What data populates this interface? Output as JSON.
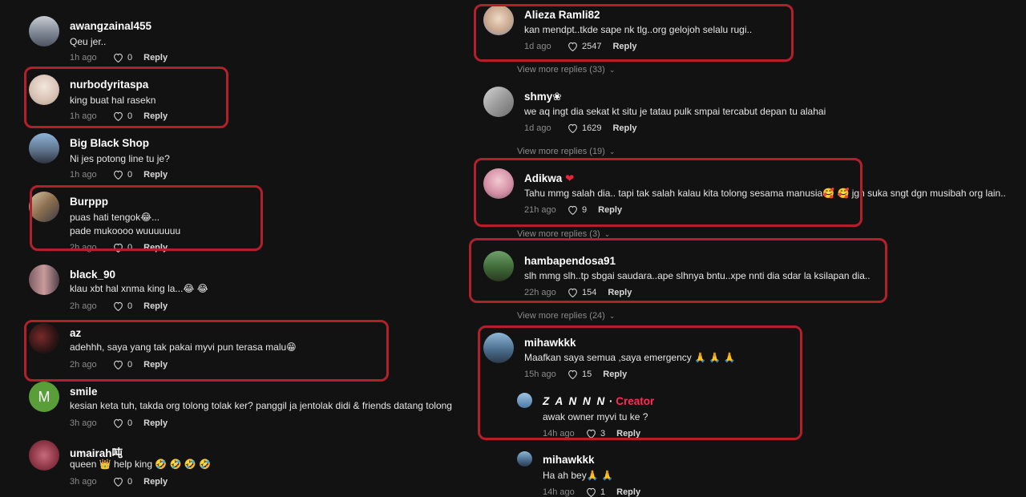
{
  "left_comments": [
    {
      "user": "awangzainal455",
      "text": "Qeu jer..",
      "age": "1h ago",
      "likes": "0",
      "reply": "Reply"
    },
    {
      "user": "nurbodyritaspa",
      "text": "king buat hal rasekn",
      "age": "1h ago",
      "likes": "0",
      "reply": "Reply"
    },
    {
      "user": "Big Black Shop",
      "text": "Ni jes potong line tu je?",
      "age": "1h ago",
      "likes": "0",
      "reply": "Reply"
    },
    {
      "user": "Burppp",
      "text": "puas hati tengok😂...",
      "text2": "pade mukoooo wuuuuuuu",
      "age": "2h ago",
      "likes": "0",
      "reply": "Reply"
    },
    {
      "user": "black_90",
      "text": "klau xbt hal xnma king la...😂 😂",
      "age": "2h ago",
      "likes": "0",
      "reply": "Reply"
    },
    {
      "user": "az",
      "text": "adehhh, saya yang tak pakai myvi pun terasa malu😁",
      "age": "2h ago",
      "likes": "0",
      "reply": "Reply"
    },
    {
      "user": "smile",
      "text": "kesian keta tuh, takda org tolong tolak ker? panggil ja jentolak didi & friends datang tolong",
      "age": "3h ago",
      "likes": "0",
      "reply": "Reply",
      "avatar_letter": "M"
    },
    {
      "user": "umairah吨",
      "text": "queen 👑 help king 🤣 🤣 🤣 🤣",
      "age": "3h ago",
      "likes": "0",
      "reply": "Reply"
    }
  ],
  "right_comments": [
    {
      "user": "Alieza Ramli82",
      "text": "kan mendpt..tkde sape nk tlg..org gelojoh selalu rugi..",
      "age": "1d ago",
      "likes": "2547",
      "reply": "Reply"
    },
    {
      "user": "shmy❀",
      "text": "we aq ingt dia sekat kt situ je tatau pulk smpai tercabut depan tu alahai",
      "age": "1d ago",
      "likes": "1629",
      "reply": "Reply"
    },
    {
      "user": "Adikwa",
      "user_badge": "❤",
      "text": "Tahu mmg salah dia.. tapi tak salah kalau kita tolong sesama manusia🥰 🥰 jgn suka sngt dgn musibah org lain..",
      "age": "21h ago",
      "likes": "9",
      "reply": "Reply"
    },
    {
      "user": "hambapendosa91",
      "text": "slh mmg slh..tp sbgai saudara..ape slhnya bntu..xpe nnti dia sdar la ksilapan dia..",
      "age": "22h ago",
      "likes": "154",
      "reply": "Reply"
    },
    {
      "user": "mihawkkk",
      "text": "Maafkan saya semua ,saya emergency 🙏 🙏 🙏",
      "age": "15h ago",
      "likes": "15",
      "reply": "Reply"
    }
  ],
  "view_more": [
    "View more replies (33)",
    "View more replies (19)",
    "View more replies (3)",
    "View more replies (24)"
  ],
  "replies": [
    {
      "user": "Z A N N N",
      "creator": "Creator",
      "text": "awak owner myvi tu ke ?",
      "age": "14h ago",
      "likes": "3",
      "reply": "Reply"
    },
    {
      "user": "mihawkkk",
      "text": "Ha ah bey🙏 🙏",
      "age": "14h ago",
      "likes": "1",
      "reply": "Reply"
    }
  ],
  "colors": {
    "background": "#121212",
    "highlight": "#b3202b",
    "creator": "#fe2c55"
  }
}
